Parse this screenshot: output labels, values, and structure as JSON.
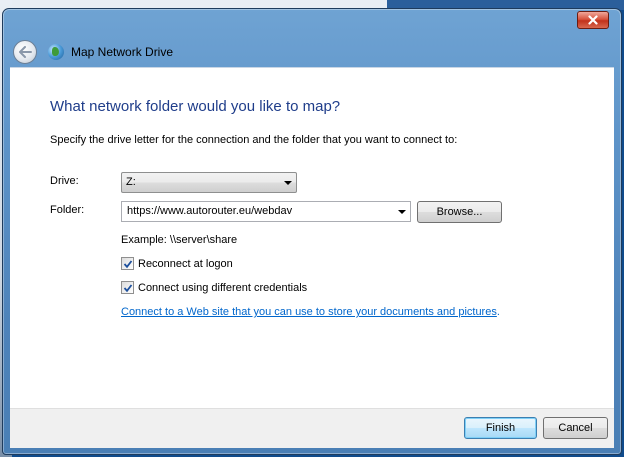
{
  "window": {
    "title": "Map Network Drive",
    "close_icon": "close-icon"
  },
  "header": {
    "back_icon": "back-arrow-icon",
    "app_icon": "network-drive-icon",
    "title": "Map Network Drive"
  },
  "main": {
    "heading": "What network folder would you like to map?",
    "instruction": "Specify the drive letter for the connection and the folder that you want to connect to:",
    "drive": {
      "label": "Drive:",
      "value": "Z:"
    },
    "folder": {
      "label": "Folder:",
      "value": "https://www.autorouter.eu/webdav",
      "browse_label": "Browse..."
    },
    "example": "Example: \\\\server\\share",
    "reconnect": {
      "label": "Reconnect at logon",
      "checked": true
    },
    "credentials": {
      "label": "Connect using different credentials",
      "checked": true
    },
    "link": {
      "text": "Connect to a Web site that you can use to store your documents and pictures",
      "suffix": "."
    }
  },
  "footer": {
    "finish_label": "Finish",
    "cancel_label": "Cancel"
  },
  "colors": {
    "heading": "#1f3d8a",
    "link": "#0066cc",
    "frame": "#5d93c8",
    "close": "#c1321b"
  }
}
